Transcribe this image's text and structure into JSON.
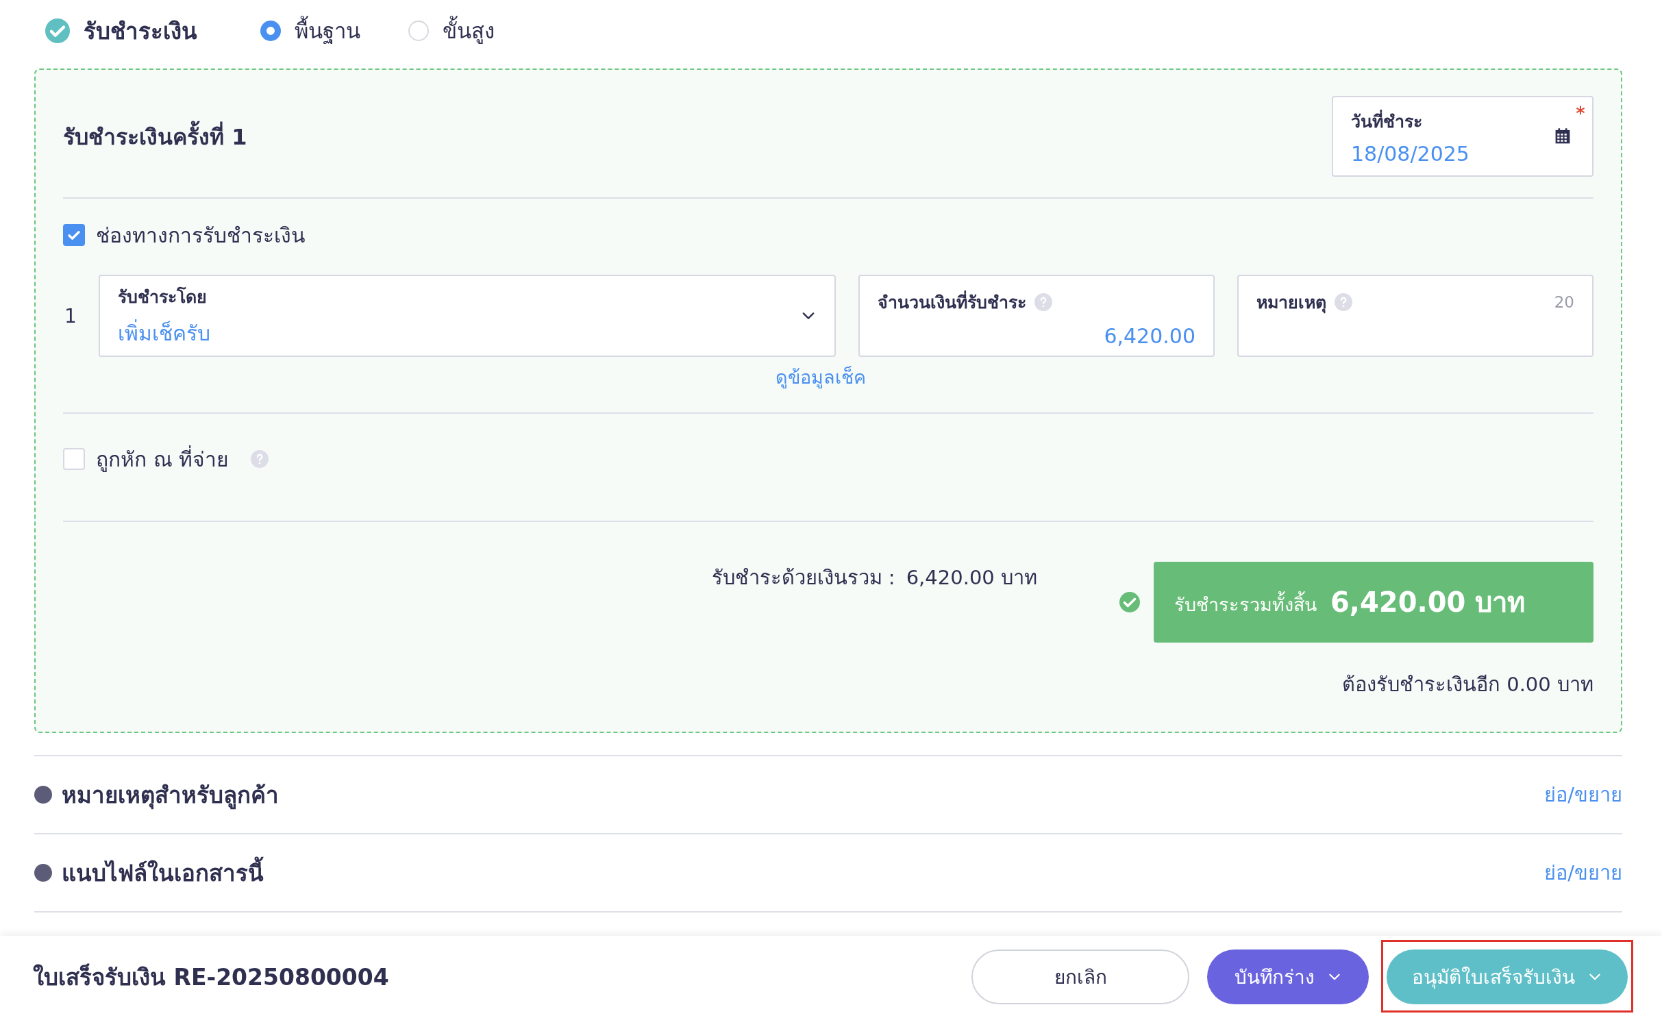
{
  "header": {
    "title": "รับชำระเงิน",
    "done": true,
    "modes": [
      {
        "label": "พื้นฐาน",
        "selected": true
      },
      {
        "label": "ขั้นสูง",
        "selected": false
      }
    ]
  },
  "payment": {
    "title": "รับชำระเงินครั้งที่ 1",
    "date_field": {
      "label": "วันที่ชำระ",
      "value": "18/08/2025",
      "required": true
    },
    "channel_option": {
      "label": "ช่องทางการรับชำระเงิน",
      "checked": true
    },
    "channels": [
      {
        "number": "1",
        "method": {
          "label": "รับชำระโดย",
          "value": "เพิ่มเช็ครับ"
        },
        "amount": {
          "label": "จำนวนเงินที่รับชำระ",
          "value": "6,420.00"
        },
        "note": {
          "label": "หมายเหตุ",
          "counter": "20"
        },
        "link": "ดูข้อมูลเช็ค"
      }
    ],
    "withholding": {
      "label": "ถูกหัก ณ ที่จ่าย",
      "checked": false
    },
    "subtotal": {
      "label": "รับชำระด้วยเงินรวม :",
      "value": "6,420.00 บาท"
    },
    "total": {
      "label": "รับชำระรวมทั้งสิ้น",
      "value": "6,420.00 บาท",
      "complete": true
    },
    "remaining": "ต้องรับชำระเงินอีก 0.00 บาท"
  },
  "sections": [
    {
      "title": "หมายเหตุสำหรับลูกค้า",
      "toggle": "ย่อ/ขยาย"
    },
    {
      "title": "แนบไฟล์ในเอกสารนี้",
      "toggle": "ย่อ/ขยาย"
    }
  ],
  "footer": {
    "document": "ใบเสร็จรับเงิน RE-20250800004",
    "buttons": [
      {
        "label": "ยกเลิก",
        "kind": "outline",
        "dropdown": false,
        "highlighted": false
      },
      {
        "label": "บันทึกร่าง",
        "kind": "draft",
        "dropdown": true,
        "highlighted": false
      },
      {
        "label": "อนุมัติใบเสร็จรับเงิน",
        "kind": "approve",
        "dropdown": true,
        "highlighted": true
      }
    ]
  }
}
